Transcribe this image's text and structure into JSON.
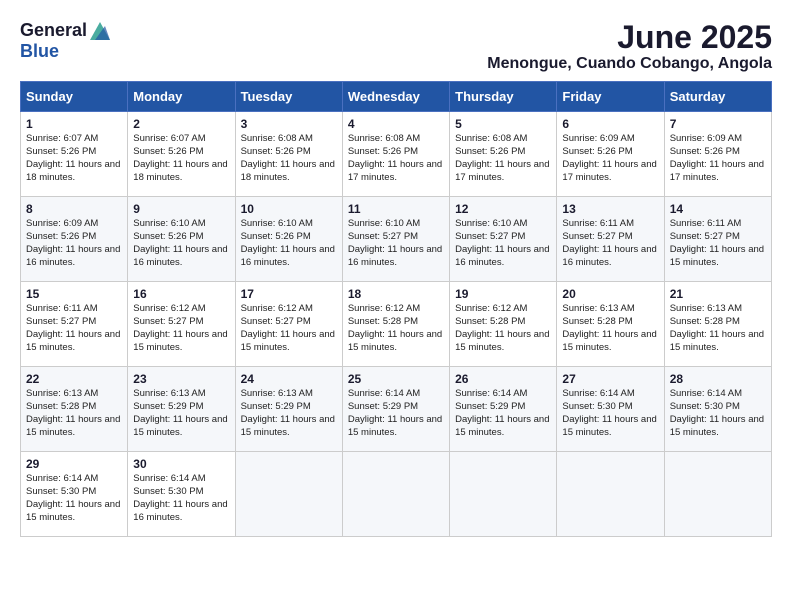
{
  "logo": {
    "general": "General",
    "blue": "Blue"
  },
  "title": {
    "month": "June 2025",
    "location": "Menongue, Cuando Cobango, Angola"
  },
  "header": {
    "days": [
      "Sunday",
      "Monday",
      "Tuesday",
      "Wednesday",
      "Thursday",
      "Friday",
      "Saturday"
    ]
  },
  "weeks": [
    [
      {
        "day": "1",
        "sunrise": "6:07 AM",
        "sunset": "5:26 PM",
        "daylight": "11 hours and 18 minutes."
      },
      {
        "day": "2",
        "sunrise": "6:07 AM",
        "sunset": "5:26 PM",
        "daylight": "11 hours and 18 minutes."
      },
      {
        "day": "3",
        "sunrise": "6:08 AM",
        "sunset": "5:26 PM",
        "daylight": "11 hours and 18 minutes."
      },
      {
        "day": "4",
        "sunrise": "6:08 AM",
        "sunset": "5:26 PM",
        "daylight": "11 hours and 17 minutes."
      },
      {
        "day": "5",
        "sunrise": "6:08 AM",
        "sunset": "5:26 PM",
        "daylight": "11 hours and 17 minutes."
      },
      {
        "day": "6",
        "sunrise": "6:09 AM",
        "sunset": "5:26 PM",
        "daylight": "11 hours and 17 minutes."
      },
      {
        "day": "7",
        "sunrise": "6:09 AM",
        "sunset": "5:26 PM",
        "daylight": "11 hours and 17 minutes."
      }
    ],
    [
      {
        "day": "8",
        "sunrise": "6:09 AM",
        "sunset": "5:26 PM",
        "daylight": "11 hours and 16 minutes."
      },
      {
        "day": "9",
        "sunrise": "6:10 AM",
        "sunset": "5:26 PM",
        "daylight": "11 hours and 16 minutes."
      },
      {
        "day": "10",
        "sunrise": "6:10 AM",
        "sunset": "5:26 PM",
        "daylight": "11 hours and 16 minutes."
      },
      {
        "day": "11",
        "sunrise": "6:10 AM",
        "sunset": "5:27 PM",
        "daylight": "11 hours and 16 minutes."
      },
      {
        "day": "12",
        "sunrise": "6:10 AM",
        "sunset": "5:27 PM",
        "daylight": "11 hours and 16 minutes."
      },
      {
        "day": "13",
        "sunrise": "6:11 AM",
        "sunset": "5:27 PM",
        "daylight": "11 hours and 16 minutes."
      },
      {
        "day": "14",
        "sunrise": "6:11 AM",
        "sunset": "5:27 PM",
        "daylight": "11 hours and 15 minutes."
      }
    ],
    [
      {
        "day": "15",
        "sunrise": "6:11 AM",
        "sunset": "5:27 PM",
        "daylight": "11 hours and 15 minutes."
      },
      {
        "day": "16",
        "sunrise": "6:12 AM",
        "sunset": "5:27 PM",
        "daylight": "11 hours and 15 minutes."
      },
      {
        "day": "17",
        "sunrise": "6:12 AM",
        "sunset": "5:27 PM",
        "daylight": "11 hours and 15 minutes."
      },
      {
        "day": "18",
        "sunrise": "6:12 AM",
        "sunset": "5:28 PM",
        "daylight": "11 hours and 15 minutes."
      },
      {
        "day": "19",
        "sunrise": "6:12 AM",
        "sunset": "5:28 PM",
        "daylight": "11 hours and 15 minutes."
      },
      {
        "day": "20",
        "sunrise": "6:13 AM",
        "sunset": "5:28 PM",
        "daylight": "11 hours and 15 minutes."
      },
      {
        "day": "21",
        "sunrise": "6:13 AM",
        "sunset": "5:28 PM",
        "daylight": "11 hours and 15 minutes."
      }
    ],
    [
      {
        "day": "22",
        "sunrise": "6:13 AM",
        "sunset": "5:28 PM",
        "daylight": "11 hours and 15 minutes."
      },
      {
        "day": "23",
        "sunrise": "6:13 AM",
        "sunset": "5:29 PM",
        "daylight": "11 hours and 15 minutes."
      },
      {
        "day": "24",
        "sunrise": "6:13 AM",
        "sunset": "5:29 PM",
        "daylight": "11 hours and 15 minutes."
      },
      {
        "day": "25",
        "sunrise": "6:14 AM",
        "sunset": "5:29 PM",
        "daylight": "11 hours and 15 minutes."
      },
      {
        "day": "26",
        "sunrise": "6:14 AM",
        "sunset": "5:29 PM",
        "daylight": "11 hours and 15 minutes."
      },
      {
        "day": "27",
        "sunrise": "6:14 AM",
        "sunset": "5:30 PM",
        "daylight": "11 hours and 15 minutes."
      },
      {
        "day": "28",
        "sunrise": "6:14 AM",
        "sunset": "5:30 PM",
        "daylight": "11 hours and 15 minutes."
      }
    ],
    [
      {
        "day": "29",
        "sunrise": "6:14 AM",
        "sunset": "5:30 PM",
        "daylight": "11 hours and 15 minutes."
      },
      {
        "day": "30",
        "sunrise": "6:14 AM",
        "sunset": "5:30 PM",
        "daylight": "11 hours and 16 minutes."
      },
      null,
      null,
      null,
      null,
      null
    ]
  ]
}
